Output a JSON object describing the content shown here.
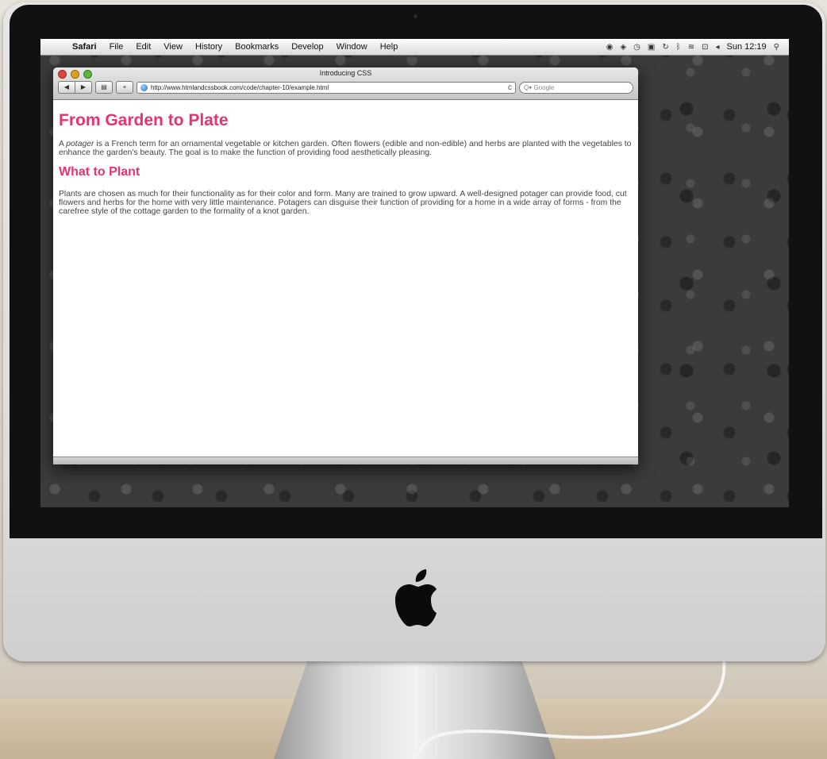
{
  "menubar": {
    "apple_symbol": "",
    "app_name": "Safari",
    "menus": [
      "File",
      "Edit",
      "View",
      "History",
      "Bookmarks",
      "Develop",
      "Window",
      "Help"
    ],
    "clock": "Sun 12:19",
    "status_icons": [
      "growl-icon",
      "evernote-icon",
      "time-machine-icon",
      "display-icon",
      "sync-icon",
      "bluetooth-icon",
      "wifi-icon",
      "flag-icon",
      "volume-icon"
    ],
    "spotlight_symbol": "⚲"
  },
  "window": {
    "title": "Introducing CSS",
    "back_symbol": "◀",
    "forward_symbol": "▶",
    "add_symbol": "+",
    "url": "http://www.htmlandcssbook.com/code/chapter-10/example.html",
    "reload_symbol": "c",
    "search_placeholder": "Q▾ Google"
  },
  "page": {
    "heading1": "From Garden to Plate",
    "para1_prefix": "A ",
    "para1_em": "potager",
    "para1_suffix": " is a French term for an ornamental vegetable or kitchen garden. Often flowers (edible and non-edible) and herbs are planted with the vegetables to enhance the garden's beauty. The goal is to make the function of providing food aesthetically pleasing.",
    "heading2": "What to Plant",
    "para2": "Plants are chosen as much for their functionality as for their color and form. Many are trained to grow upward. A well-designed potager can provide food, cut flowers and herbs for the home with very little maintenance. Potagers can disguise their function of providing for a home in a wide array of forms - from the carefree style of the cottage garden to the formality of a knot garden."
  },
  "colors": {
    "heading": "#e6346e",
    "body_text": "#444444"
  }
}
